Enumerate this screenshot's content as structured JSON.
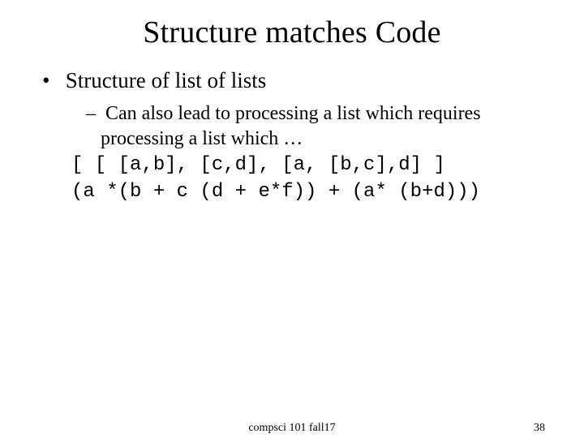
{
  "title": "Structure matches Code",
  "bullets": {
    "top": "Structure of list of lists",
    "sub": "Can also lead to processing a list which requires processing a list which …"
  },
  "code": {
    "line1": "[ [ [a,b], [c,d], [a, [b,c],d] ]",
    "line2": "(a *(b + c (d + e*f)) + (a* (b+d)))"
  },
  "footer": {
    "center": "compsci 101 fall17",
    "page": "38"
  }
}
